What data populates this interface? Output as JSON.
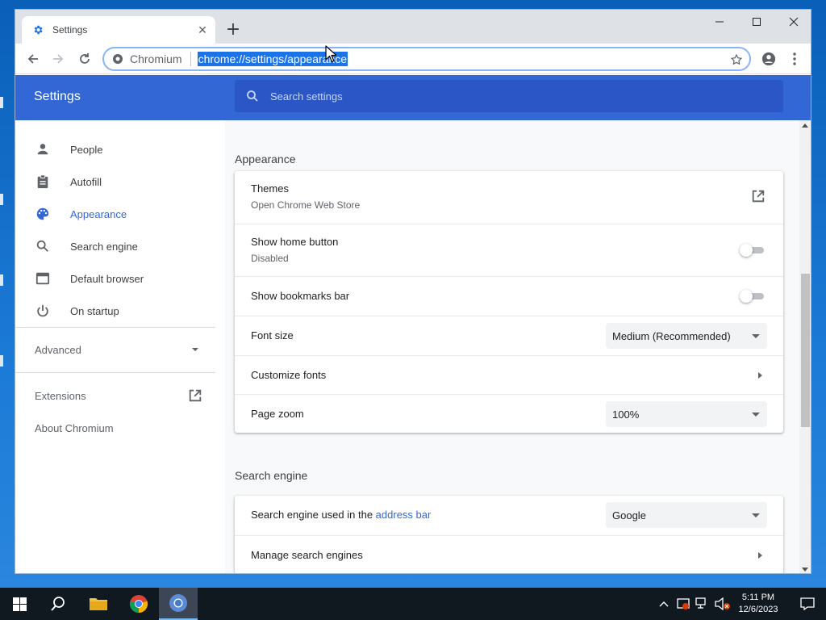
{
  "browser": {
    "tab_title": "Settings",
    "site_name": "Chromium",
    "url": "chrome://settings/appearance"
  },
  "settings": {
    "header_title": "Settings",
    "search_placeholder": "Search settings",
    "sidebar": {
      "items": [
        {
          "label": "People",
          "icon": "person-icon"
        },
        {
          "label": "Autofill",
          "icon": "clipboard-icon"
        },
        {
          "label": "Appearance",
          "icon": "palette-icon",
          "active": true
        },
        {
          "label": "Search engine",
          "icon": "search-icon"
        },
        {
          "label": "Default browser",
          "icon": "browser-window-icon"
        },
        {
          "label": "On startup",
          "icon": "power-icon"
        }
      ],
      "advanced": "Advanced",
      "extensions": "Extensions",
      "about": "About Chromium"
    },
    "appearance": {
      "title": "Appearance",
      "themes_label": "Themes",
      "themes_sub": "Open Chrome Web Store",
      "home_label": "Show home button",
      "home_sub": "Disabled",
      "home_enabled": false,
      "bookmarks_label": "Show bookmarks bar",
      "bookmarks_enabled": false,
      "font_size_label": "Font size",
      "font_size_value": "Medium (Recommended)",
      "customize_fonts_label": "Customize fonts",
      "page_zoom_label": "Page zoom",
      "page_zoom_value": "100%"
    },
    "search_engine": {
      "title": "Search engine",
      "used_label_prefix": "Search engine used in the ",
      "used_label_link": "address bar",
      "engine_value": "Google",
      "manage_label": "Manage search engines"
    }
  },
  "taskbar": {
    "time": "5:11 PM",
    "date": "12/6/2023"
  },
  "colors": {
    "accent": "#3367d6",
    "header_bg": "#3367d6",
    "selection": "#1a73e8"
  }
}
